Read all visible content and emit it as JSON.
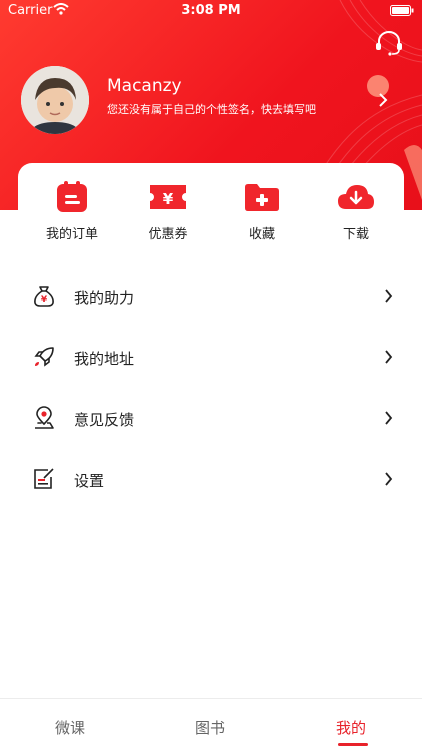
{
  "status_bar": {
    "carrier": "Carrier",
    "time": "3:08 PM"
  },
  "profile": {
    "username": "Macanzy",
    "signature": "您还没有属于自己的个性签名，快去填写吧"
  },
  "quick_actions": [
    {
      "label": "我的订单",
      "icon": "order-icon"
    },
    {
      "label": "优惠券",
      "icon": "coupon-icon"
    },
    {
      "label": "收藏",
      "icon": "favorite-folder-icon"
    },
    {
      "label": "下载",
      "icon": "download-cloud-icon"
    }
  ],
  "menu": [
    {
      "label": "我的助力",
      "icon": "money-bag-icon"
    },
    {
      "label": "我的地址",
      "icon": "rocket-icon"
    },
    {
      "label": "意见反馈",
      "icon": "location-pin-icon"
    },
    {
      "label": "设置",
      "icon": "edit-note-icon"
    }
  ],
  "tabs": [
    {
      "label": "微课"
    },
    {
      "label": "图书"
    },
    {
      "label": "我的"
    }
  ],
  "active_tab": "我的",
  "colors": {
    "accent": "#e8222a",
    "header": "#f0141e"
  }
}
